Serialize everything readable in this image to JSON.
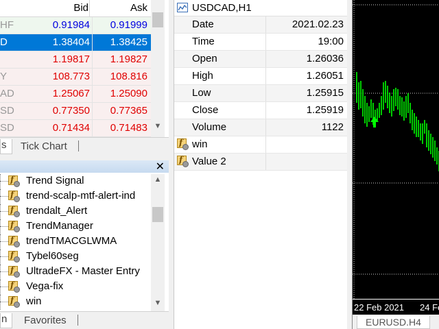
{
  "market_watch": {
    "headers": {
      "symbol": "",
      "bid": "Bid",
      "ask": "Ask"
    },
    "rows": [
      {
        "symbol": "HF",
        "bid": "0.91984",
        "ask": "0.91999",
        "trend": "up",
        "selected": false
      },
      {
        "symbol": "D",
        "bid": "1.38404",
        "ask": "1.38425",
        "trend": "up",
        "selected": true
      },
      {
        "symbol": "",
        "bid": "1.19817",
        "ask": "1.19827",
        "trend": "dn",
        "selected": false
      },
      {
        "symbol": "Y",
        "bid": "108.773",
        "ask": "108.816",
        "trend": "dn",
        "selected": false
      },
      {
        "symbol": "AD",
        "bid": "1.25067",
        "ask": "1.25090",
        "trend": "dn",
        "selected": false
      },
      {
        "symbol": "SD",
        "bid": "0.77350",
        "ask": "0.77365",
        "trend": "dn",
        "selected": false
      },
      {
        "symbol": "SD",
        "bid": "0.71434",
        "ask": "0.71483",
        "trend": "dn",
        "selected": false
      }
    ],
    "tabs": [
      {
        "label": "s"
      },
      {
        "label": "Tick Chart"
      }
    ]
  },
  "navigator": {
    "items": [
      "Trend Signal",
      "trend-scalp-mtf-alert-ind",
      "trendalt_Alert",
      "TrendManager",
      "trendTMACGLWMA",
      "Tybel60seg",
      "UltradeFX - Master Entry",
      "Vega-fix",
      "win"
    ],
    "close_glyph": "✕",
    "tabs": [
      {
        "label": "n"
      },
      {
        "label": "Favorites"
      }
    ]
  },
  "data_window": {
    "title": "USDCAD,H1",
    "rows": [
      {
        "key": "Date",
        "value": "2021.02.23"
      },
      {
        "key": "Time",
        "value": "19:00"
      },
      {
        "key": "Open",
        "value": "1.26036"
      },
      {
        "key": "High",
        "value": "1.26051"
      },
      {
        "key": "Low",
        "value": "1.25915"
      },
      {
        "key": "Close",
        "value": "1.25919"
      },
      {
        "key": "Volume",
        "value": "1122"
      }
    ],
    "indicators": [
      {
        "key": "win",
        "value": ""
      },
      {
        "key": "Value 2",
        "value": ""
      }
    ]
  },
  "chart": {
    "time_labels": [
      "22 Feb 2021",
      "24 Fe"
    ],
    "tab_label": "EURUSD.H4",
    "bar_color": "#00ff00",
    "grid_color": "#cfcfcf"
  }
}
